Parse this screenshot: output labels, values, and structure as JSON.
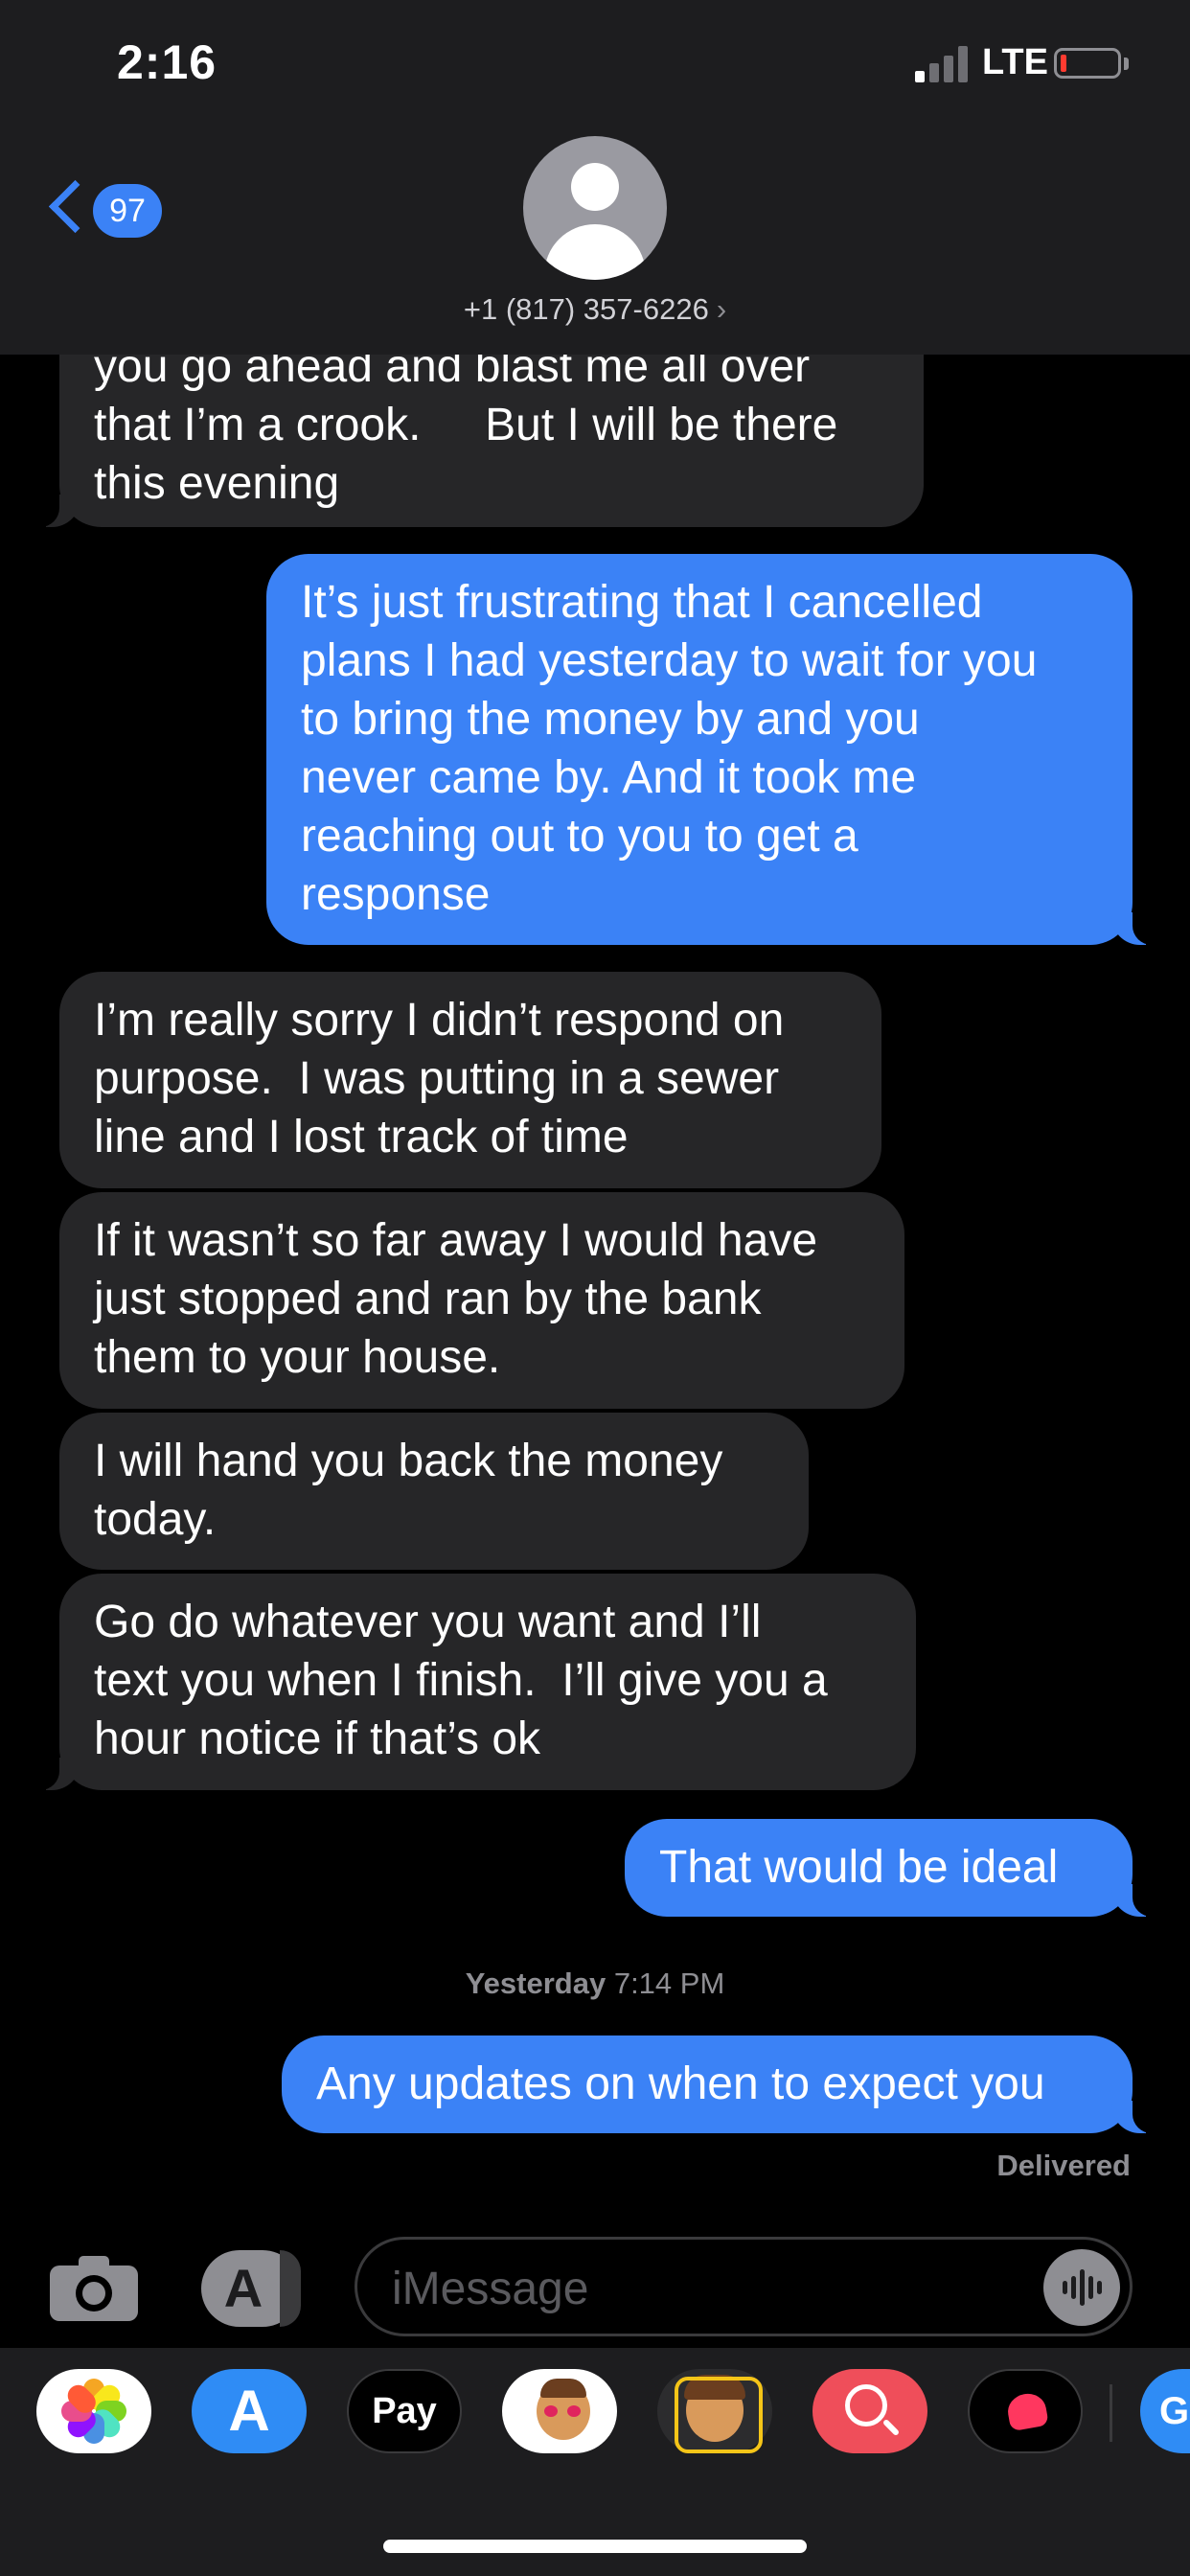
{
  "status_bar": {
    "time": "2:16",
    "network": "LTE"
  },
  "header": {
    "back_count": "97",
    "contact": "+1 (817) 357-6226",
    "contact_arrow": "›"
  },
  "messages": [
    {
      "from": "them",
      "text": "you go ahead and blast me all over\nthat I’m a crook.     But I will be there\nthis evening"
    },
    {
      "from": "me",
      "text": "It’s just frustrating that I cancelled\nplans I had yesterday to wait for you\nto bring the money by and you\nnever came by. And it took me\nreaching out to you to get a\nresponse"
    },
    {
      "from": "them",
      "text": "I’m really sorry I didn’t respond on\npurpose.  I was putting in a sewer\nline and I lost track of time"
    },
    {
      "from": "them",
      "text": "If it wasn’t so far away I would have\njust stopped and ran by the bank\nthem to your house."
    },
    {
      "from": "them",
      "text": "I will hand you back the money\ntoday."
    },
    {
      "from": "them",
      "text": "Go do whatever you want and I’ll\ntext you when I finish.  I’ll give you a\nhour notice if that’s ok"
    },
    {
      "from": "me",
      "text": "That would be ideal"
    },
    {
      "from": "me",
      "text": "Any updates on when to expect you"
    }
  ],
  "timestamp": {
    "day": "Yesterday",
    "time": "7:14 PM"
  },
  "delivered": "Delivered",
  "composer": {
    "placeholder": "iMessage"
  },
  "app_drawer": {
    "applepay_label": "Pay",
    "partial_app_letter": "G"
  },
  "colors": {
    "outgoing": "#3b82f6",
    "incoming": "#262628",
    "background": "#000000"
  },
  "icons": [
    "back-chevron-icon",
    "contact-avatar-icon",
    "camera-icon",
    "app-store-icon",
    "audio-waveform-icon",
    "photos-icon",
    "apple-pay-icon",
    "memoji-icon",
    "web-search-icon",
    "digital-touch-icon"
  ]
}
